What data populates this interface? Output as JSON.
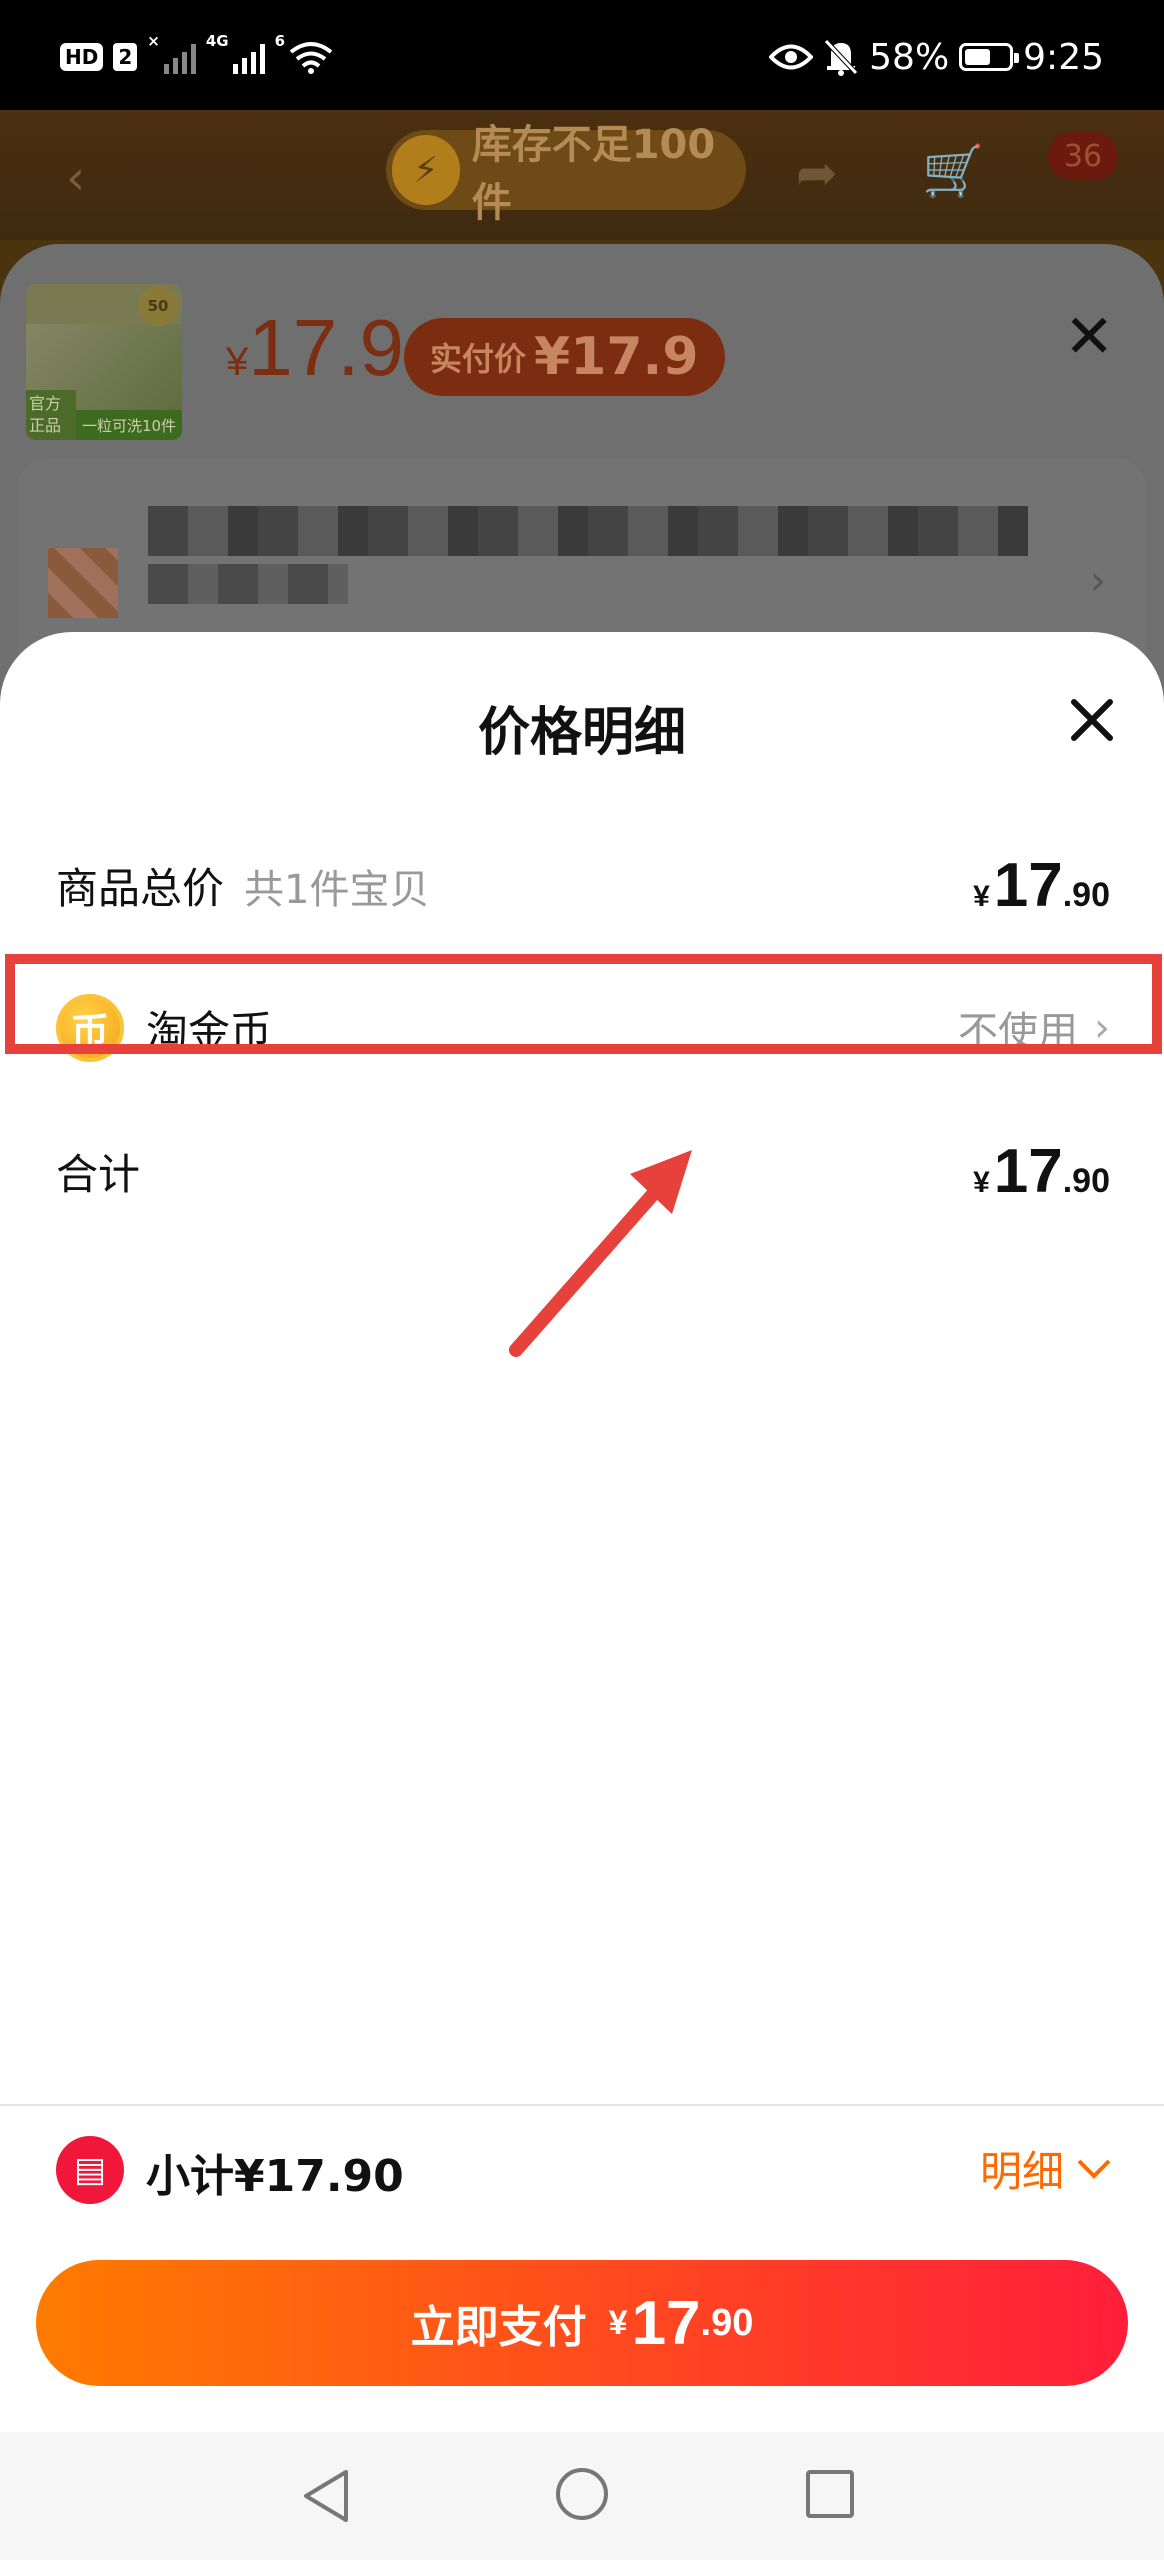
{
  "status_bar": {
    "hd": "HD",
    "sim": "2",
    "net1": "×",
    "net2": "4G",
    "wifi_gen": "6",
    "battery_text": "58%",
    "time": "9:25"
  },
  "background": {
    "stock_notice": "库存不足100件",
    "cart_badge": "36",
    "product": {
      "price_currency": "¥",
      "price": "17.9",
      "real_pay_label": "实付价",
      "real_pay_amount": "¥17.9",
      "thumb_top_badge": "50",
      "thumb_corner": "官方正品",
      "thumb_bottom": "一粒可洗10件"
    }
  },
  "sheet": {
    "title": "价格明细",
    "rows": [
      {
        "label": "商品总价",
        "sub": "共1件宝贝",
        "currency": "¥",
        "integer": "17",
        "decimal": ".90"
      },
      {
        "coin_glyph": "币",
        "label": "淘金币",
        "status": "不使用"
      },
      {
        "label": "合计",
        "currency": "¥",
        "integer": "17",
        "decimal": ".90"
      }
    ],
    "subtotal": "小计¥17.90",
    "detail_label": "明细",
    "pay_button": {
      "label": "立即支付",
      "currency": "¥",
      "integer": "17",
      "decimal": ".90"
    }
  },
  "colors": {
    "accent_orange": "#ff6a00",
    "pay_gradient_start": "#ff7b00",
    "pay_gradient_end": "#ff1e3a",
    "annotation_red": "#e7413b"
  }
}
